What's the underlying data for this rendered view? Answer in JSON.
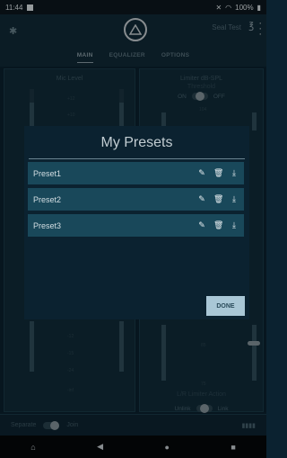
{
  "status": {
    "time": "11:44",
    "battery": "100%"
  },
  "header": {
    "device_name": "Seal Test"
  },
  "tabs": [
    {
      "label": "MAIN",
      "active": true
    },
    {
      "label": "EQUALIZER",
      "active": false
    },
    {
      "label": "OPTIONS",
      "active": false
    }
  ],
  "left_panel": {
    "title": "Mic Level",
    "scale_top": [
      "+12",
      "+10"
    ],
    "scale_bottom": [
      "-12",
      "-15",
      "-24",
      "-inf"
    ]
  },
  "right_panel": {
    "title": "Limiter dB-SPL",
    "subtitle": "Threshold",
    "toggle_on": "ON",
    "toggle_off": "OFF",
    "scale_top": "104",
    "scale_bottom": [
      "85",
      "75"
    ],
    "lr_label": "L/R Limiter Action",
    "unlink": "Unlink",
    "link": "Link"
  },
  "bottom": {
    "separate": "Separate",
    "join": "Join"
  },
  "dialog": {
    "title": "My Presets",
    "presets": [
      {
        "name": "Preset1"
      },
      {
        "name": "Preset2"
      },
      {
        "name": "Preset3"
      }
    ],
    "done_label": "DONE"
  },
  "icons": [
    "bluetooth-icon",
    "logo-icon",
    "ear-icon",
    "more-icon",
    "edit-icon",
    "delete-icon",
    "download-icon",
    "home-icon",
    "back-icon",
    "circle-icon",
    "square-icon"
  ]
}
